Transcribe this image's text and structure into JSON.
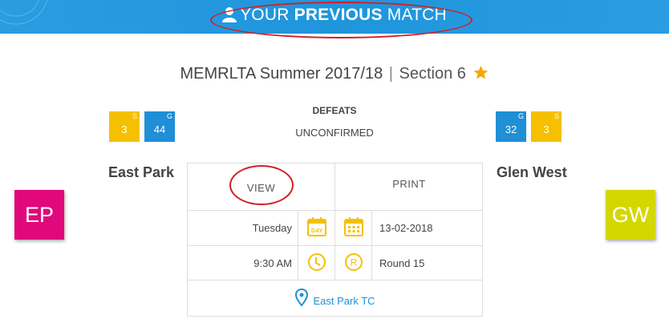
{
  "header": {
    "title_pre": "YOUR ",
    "title_bold": "PREVIOUS",
    "title_post": " MATCH",
    "icon": "user-icon",
    "bg_color": "#2a9de0"
  },
  "competition": {
    "name": "MEMRLTA Summer 2017/18",
    "separator": "|",
    "section": "Section 6",
    "favorite_icon": "star-icon",
    "star_color": "#f5a800"
  },
  "result": {
    "label": "DEFEATS",
    "status": "UNCONFIRMED"
  },
  "home": {
    "name": "East Park",
    "initials": "EP",
    "logo_color": "#e0087a",
    "sets": {
      "value": "3",
      "label": "S",
      "color": "#f5c000"
    },
    "games": {
      "value": "44",
      "label": "G",
      "color": "#1f8fd6"
    }
  },
  "away": {
    "name": "Glen West",
    "initials": "GW",
    "logo_color": "#d4d800",
    "games": {
      "value": "32",
      "label": "G",
      "color": "#1f8fd6"
    },
    "sets": {
      "value": "3",
      "label": "S",
      "color": "#f5c000"
    }
  },
  "actions": {
    "view": "VIEW",
    "print": "PRINT"
  },
  "details": {
    "day": "Tuesday",
    "day_icon_label": "DAY",
    "date": "13-02-2018",
    "time": "9:30 AM",
    "round_icon_label": "R",
    "round": "Round 15",
    "venue": "East Park TC",
    "icon_color": "#f5c000"
  }
}
